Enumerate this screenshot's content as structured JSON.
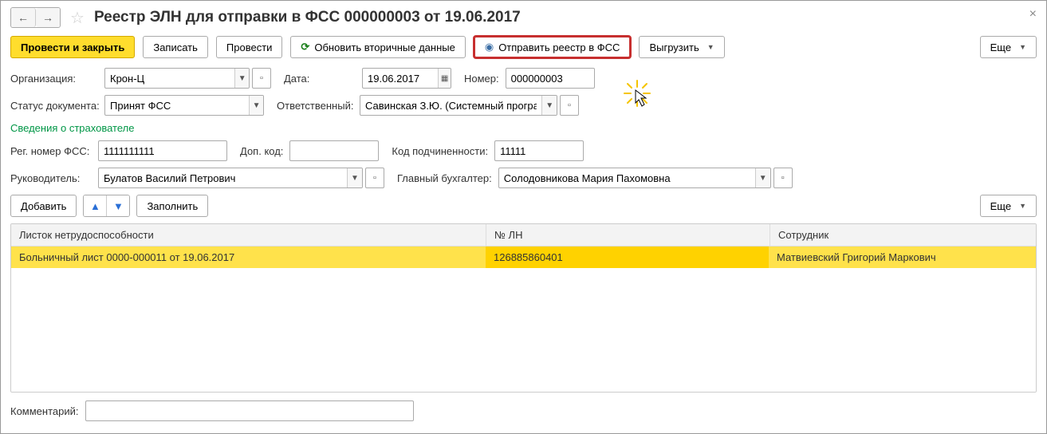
{
  "title": "Реестр ЭЛН для отправки в ФСС 000000003 от 19.06.2017",
  "toolbar": {
    "post_close": "Провести и закрыть",
    "save": "Записать",
    "post": "Провести",
    "refresh": "Обновить вторичные данные",
    "send": "Отправить реестр в ФСС",
    "export": "Выгрузить",
    "more": "Еще"
  },
  "labels": {
    "org": "Организация:",
    "date": "Дата:",
    "number": "Номер:",
    "status": "Статус документа:",
    "responsible": "Ответственный:",
    "insurer_section": "Сведения о страхователе",
    "reg_fss": "Рег. номер ФСС:",
    "dop_code": "Доп. код:",
    "sub_code": "Код подчиненности:",
    "head": "Руководитель:",
    "accountant": "Главный бухгалтер:",
    "add": "Добавить",
    "fill": "Заполнить",
    "more2": "Еще",
    "comment": "Комментарий:"
  },
  "fields": {
    "org": "Крон-Ц",
    "date": "19.06.2017",
    "number": "000000003",
    "status": "Принят ФСС",
    "responsible": "Савинская З.Ю. (Системный програм",
    "reg_fss": "1111111111",
    "dop_code": "",
    "sub_code": "11111",
    "head": "Булатов Василий Петрович",
    "accountant": "Солодовникова Мария Пахомовна",
    "comment": ""
  },
  "table": {
    "headers": {
      "c1": "Листок нетрудоспособности",
      "c2": "№ ЛН",
      "c3": "Сотрудник"
    },
    "rows": [
      {
        "c1": "Больничный лист 0000-000011 от 19.06.2017",
        "c2": "126885860401",
        "c3": "Матвиевский Григорий Маркович"
      }
    ]
  }
}
